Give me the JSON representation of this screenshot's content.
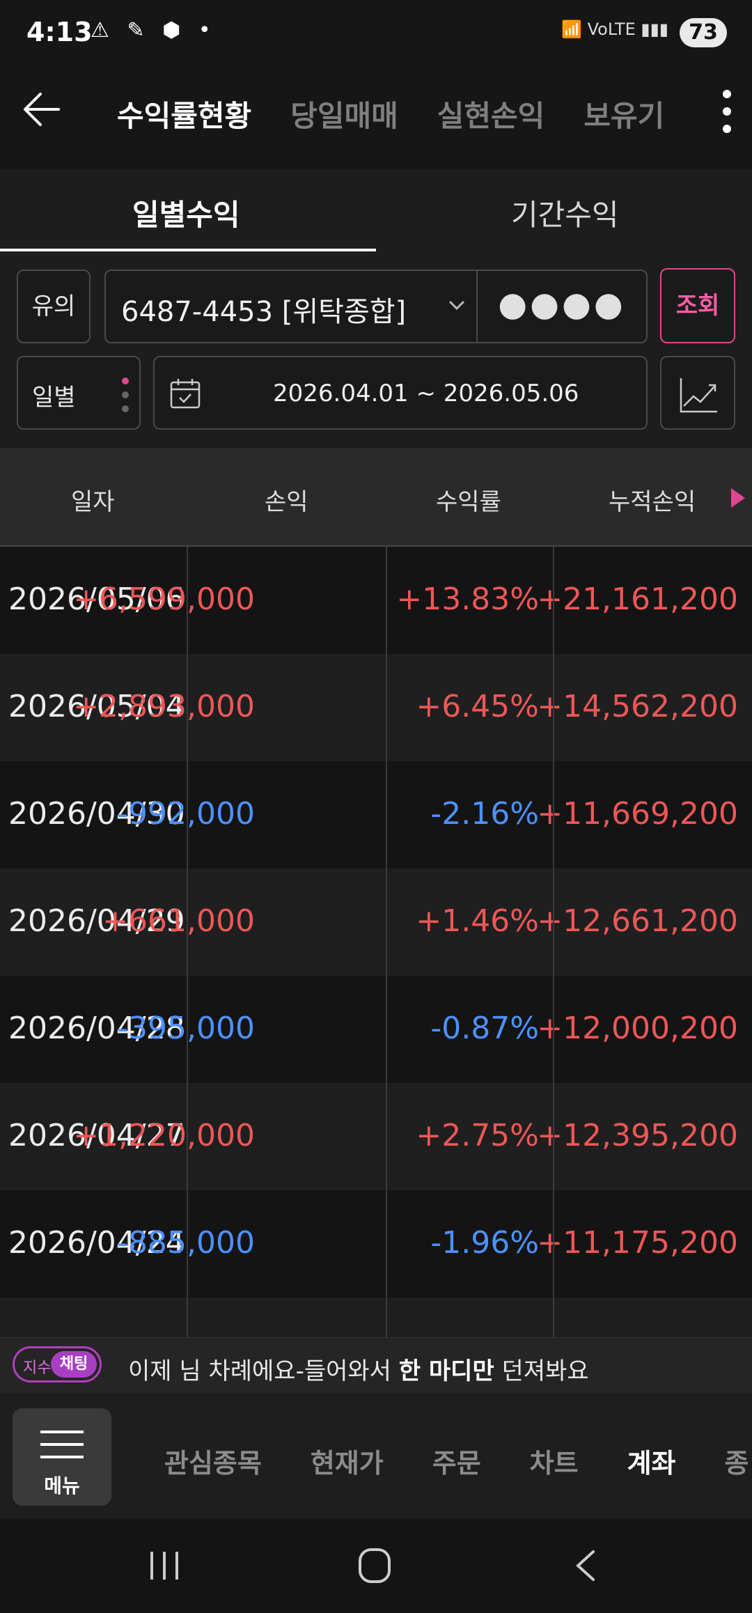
{
  "status_bar": {
    "time": "4:13",
    "left_icons": "⚠ ✎ ⬢ •",
    "right_icons": "📶 VoLTE ▮▮▮",
    "battery": "73"
  },
  "header": {
    "tabs": [
      {
        "label": "수익률현황",
        "active": true
      },
      {
        "label": "당일매매",
        "active": false
      },
      {
        "label": "실현손익",
        "active": false
      },
      {
        "label": "보유기",
        "active": false
      }
    ]
  },
  "subtabs": [
    "일별수익",
    "기간수익"
  ],
  "controls": {
    "caution_label": "유의",
    "account_number": "6487-4453 [위탁종합]",
    "password_mask": "●●●●",
    "query_button": "조회",
    "period_label": "일별",
    "date_range": "2026.04.01 ~ 2026.05.06"
  },
  "table": {
    "headers": [
      "일자",
      "손익",
      "수익률",
      "누적손익"
    ],
    "rows": [
      {
        "date": "2026/05/06",
        "pl": "+6,599,000",
        "rate": "+13.83%",
        "acc": "+21,161,200",
        "sign": "pos"
      },
      {
        "date": "2026/05/04",
        "pl": "+2,893,000",
        "rate": "+6.45%",
        "acc": "+14,562,200",
        "sign": "pos"
      },
      {
        "date": "2026/04/30",
        "pl": "-992,000",
        "rate": "-2.16%",
        "acc": "+11,669,200",
        "sign": "neg"
      },
      {
        "date": "2026/04/29",
        "pl": "+661,000",
        "rate": "+1.46%",
        "acc": "+12,661,200",
        "sign": "pos"
      },
      {
        "date": "2026/04/28",
        "pl": "-395,000",
        "rate": "-0.87%",
        "acc": "+12,000,200",
        "sign": "neg"
      },
      {
        "date": "2026/04/27",
        "pl": "+1,220,000",
        "rate": "+2.75%",
        "acc": "+12,395,200",
        "sign": "pos"
      },
      {
        "date": "2026/04/24",
        "pl": "-885,000",
        "rate": "-1.96%",
        "acc": "+11,175,200",
        "sign": "neg"
      }
    ]
  },
  "banner": {
    "pill_left": "지수",
    "pill_right": "채팅",
    "message_pre": "이제 님 차례에요-들어와서 ",
    "message_bold": "한 마디만",
    "message_post": " 던져봐요"
  },
  "bottom_nav": {
    "menu_label": "메뉴",
    "items": [
      {
        "label": "관심종목",
        "active": false
      },
      {
        "label": "현재가",
        "active": false
      },
      {
        "label": "주문",
        "active": false
      },
      {
        "label": "차트",
        "active": false
      },
      {
        "label": "계좌",
        "active": true
      },
      {
        "label": "종",
        "active": false
      }
    ]
  },
  "colors": {
    "positive": "#ee5757",
    "negative": "#4c92ff",
    "accent": "#e04690"
  }
}
